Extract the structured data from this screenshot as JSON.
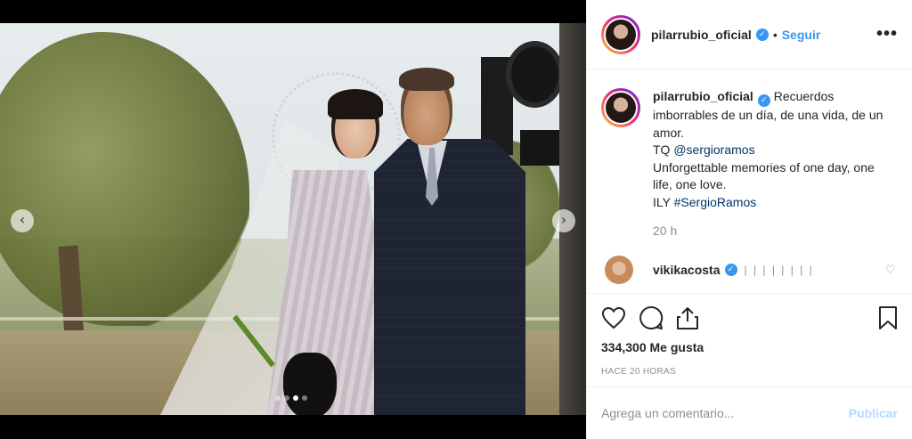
{
  "post": {
    "username": "pilarrubio_oficial",
    "separator": "•",
    "follow_label": "Seguir",
    "more_label": "•••",
    "verified_glyph": "✓"
  },
  "caption": {
    "username": "pilarrubio_oficial",
    "text_1": "Recuerdos imborrables de un día, de una vida, de un amor.",
    "tq_prefix": "TQ ",
    "mention": "@sergioramos",
    "text_2": "Unforgettable memories of one day, one life, one love.",
    "ily_prefix": "ILY ",
    "hashtag": "#SergioRamos",
    "age": "20 h"
  },
  "reply": {
    "username": "vikikacosta",
    "text": "| | | | | | | |"
  },
  "stats": {
    "likes": "334,300 Me gusta",
    "time": "HACE 20 HORAS"
  },
  "comment_box": {
    "placeholder": "Agrega un comentario...",
    "publish_label": "Publicar"
  },
  "carousel": {
    "prev_glyph": "‹",
    "next_glyph": "›",
    "slide_count": 4,
    "active_index": 2
  },
  "icons": [
    "heart-icon",
    "comment-icon",
    "share-icon",
    "bookmark-icon",
    "verified-icon",
    "more-icon"
  ],
  "colors": {
    "accent": "#3897f0",
    "publish_disabled": "#b3dbff",
    "muted": "#8e8e8e",
    "link": "#003569"
  }
}
